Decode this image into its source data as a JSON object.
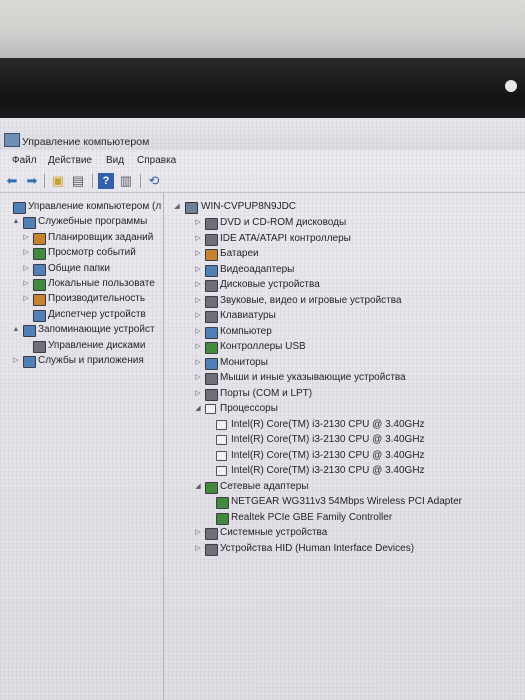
{
  "window": {
    "title": "Управление компьютером"
  },
  "menu": [
    "Файл",
    "Действие",
    "Вид",
    "Справка"
  ],
  "toolbar_icons": [
    "back-arrow-icon",
    "forward-arrow-icon",
    "up-folder-icon",
    "show-hide-tree-icon",
    "help-icon",
    "properties-icon",
    "scan-hardware-icon"
  ],
  "left_tree": [
    {
      "label": "Управление компьютером (л",
      "icon": "computer-management-icon",
      "level": 0,
      "expander": ""
    },
    {
      "label": "Служебные программы",
      "icon": "tools-icon",
      "level": 1,
      "expander": "▲"
    },
    {
      "label": "Планировщик заданий",
      "icon": "clock-icon",
      "level": 2,
      "expander": "▷"
    },
    {
      "label": "Просмотр событий",
      "icon": "event-viewer-icon",
      "level": 2,
      "expander": "▷"
    },
    {
      "label": "Общие папки",
      "icon": "shared-folders-icon",
      "level": 2,
      "expander": "▷"
    },
    {
      "label": "Локальные пользовате",
      "icon": "users-icon",
      "level": 2,
      "expander": "▷"
    },
    {
      "label": "Производительность",
      "icon": "performance-icon",
      "level": 2,
      "expander": "▷"
    },
    {
      "label": "Диспетчер устройств",
      "icon": "device-manager-icon",
      "level": 2,
      "expander": ""
    },
    {
      "label": "Запоминающие устройст",
      "icon": "storage-icon",
      "level": 1,
      "expander": "▲"
    },
    {
      "label": "Управление дисками",
      "icon": "disk-management-icon",
      "level": 2,
      "expander": ""
    },
    {
      "label": "Службы и приложения",
      "icon": "services-icon",
      "level": 1,
      "expander": "▷"
    }
  ],
  "device_tree": {
    "root": "WIN-CVPUP8N9JDC",
    "items": [
      {
        "label": "DVD и CD-ROM дисководы",
        "icon": "dvd-drive-icon",
        "level": 1,
        "expander": "▷"
      },
      {
        "label": "IDE ATA/ATAPI контроллеры",
        "icon": "ide-controller-icon",
        "level": 1,
        "expander": "▷"
      },
      {
        "label": "Батареи",
        "icon": "battery-icon",
        "level": 1,
        "expander": "▷"
      },
      {
        "label": "Видеоадаптеры",
        "icon": "display-adapter-icon",
        "level": 1,
        "expander": "▷"
      },
      {
        "label": "Дисковые устройства",
        "icon": "disk-drive-icon",
        "level": 1,
        "expander": "▷"
      },
      {
        "label": "Звуковые, видео и игровые устройства",
        "icon": "sound-icon",
        "level": 1,
        "expander": "▷"
      },
      {
        "label": "Клавиатуры",
        "icon": "keyboard-icon",
        "level": 1,
        "expander": "▷"
      },
      {
        "label": "Компьютер",
        "icon": "computer-icon",
        "level": 1,
        "expander": "▷"
      },
      {
        "label": "Контроллеры USB",
        "icon": "usb-icon",
        "level": 1,
        "expander": "▷"
      },
      {
        "label": "Мониторы",
        "icon": "monitor-icon",
        "level": 1,
        "expander": "▷"
      },
      {
        "label": "Мыши и иные указывающие устройства",
        "icon": "mouse-icon",
        "level": 1,
        "expander": "▷"
      },
      {
        "label": "Порты (COM и LPT)",
        "icon": "port-icon",
        "level": 1,
        "expander": "▷"
      },
      {
        "label": "Процессоры",
        "icon": "processor-icon",
        "level": 1,
        "expander": "◢"
      },
      {
        "label": "Intel(R) Core(TM) i3-2130 CPU @ 3.40GHz",
        "icon": "cpu-icon",
        "level": 2,
        "expander": ""
      },
      {
        "label": "Intel(R) Core(TM) i3-2130 CPU @ 3.40GHz",
        "icon": "cpu-icon",
        "level": 2,
        "expander": ""
      },
      {
        "label": "Intel(R) Core(TM) i3-2130 CPU @ 3.40GHz",
        "icon": "cpu-icon",
        "level": 2,
        "expander": ""
      },
      {
        "label": "Intel(R) Core(TM) i3-2130 CPU @ 3.40GHz",
        "icon": "cpu-icon",
        "level": 2,
        "expander": ""
      },
      {
        "label": "Сетевые адаптеры",
        "icon": "network-adapter-icon",
        "level": 1,
        "expander": "◢"
      },
      {
        "label": "NETGEAR WG311v3 54Mbps Wireless PCI Adapter",
        "icon": "network-card-icon",
        "level": 2,
        "expander": ""
      },
      {
        "label": "Realtek PCIe GBE Family Controller",
        "icon": "network-card-icon",
        "level": 2,
        "expander": ""
      },
      {
        "label": "Системные устройства",
        "icon": "system-devices-icon",
        "level": 1,
        "expander": "▷"
      },
      {
        "label": "Устройства HID (Human Interface Devices)",
        "icon": "hid-icon",
        "level": 1,
        "expander": "▷"
      }
    ]
  },
  "colors": {
    "tree_icon_blue": "#4f7fb8",
    "tree_icon_green": "#3f8a3a",
    "tree_icon_gray": "#6e6e78",
    "tree_icon_orange": "#c9822a"
  }
}
